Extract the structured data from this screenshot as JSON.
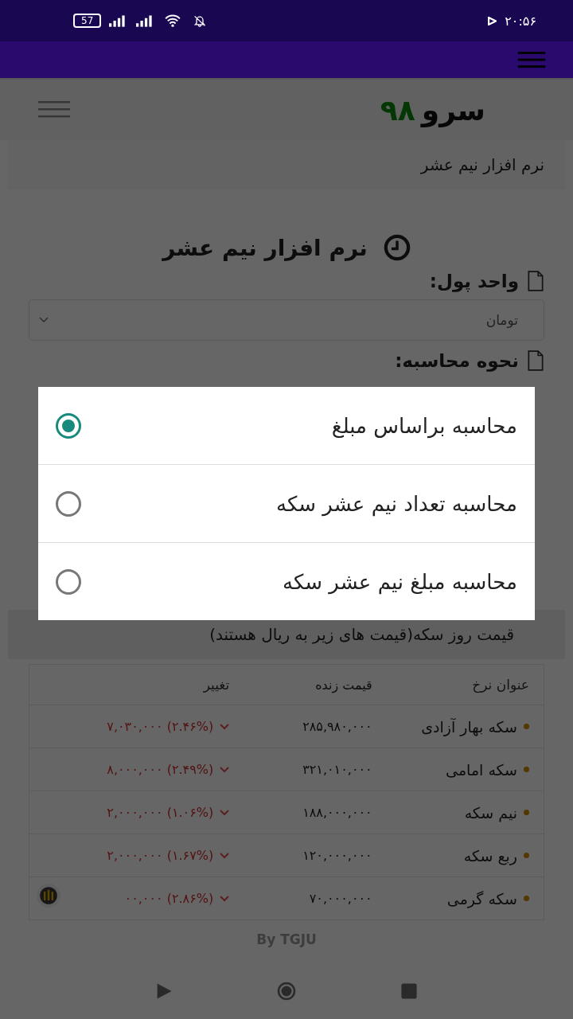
{
  "status_bar": {
    "battery": "57",
    "time": "۲۰:۵۶"
  },
  "header": {
    "logo_name": "سرو",
    "logo_number": "۹۸"
  },
  "breadcrumb": "نرم افزار نیم عشر",
  "form": {
    "title": "نرم افزار نیم عشر",
    "currency_label": "واحد پول:",
    "currency_value": "تومان",
    "method_label": "نحوه محاسبه:"
  },
  "prices": {
    "heading": "قیمت روز سکه(قیمت های زیر به ریال هستند)",
    "columns": [
      "عنوان نرخ",
      "قیمت زنده",
      "تغییر"
    ],
    "rows": [
      {
        "name": "سکه بهار آزادی",
        "price": "۲۸۵,۹۸۰,۰۰۰",
        "change": "۷,۰۳۰,۰۰۰ (۲.۴۶%)"
      },
      {
        "name": "سکه امامی",
        "price": "۳۲۱,۰۱۰,۰۰۰",
        "change": "۸,۰۰۰,۰۰۰ (۲.۴۹%)"
      },
      {
        "name": "نیم سکه",
        "price": "۱۸۸,۰۰۰,۰۰۰",
        "change": "۲,۰۰۰,۰۰۰ (۱.۰۶%)"
      },
      {
        "name": "ربع سکه",
        "price": "۱۲۰,۰۰۰,۰۰۰",
        "change": "۲,۰۰۰,۰۰۰ (۱.۶۷%)"
      },
      {
        "name": "سکه گرمی",
        "price": "۷۰,۰۰۰,۰۰۰",
        "change": "۰۰,۰۰۰ (۲.۸۶%)"
      }
    ],
    "credit": "By TGJU"
  },
  "dialog": {
    "options": [
      {
        "label": "محاسبه براساس مبلغ",
        "selected": true
      },
      {
        "label": "محاسبه تعداد نیم عشر سکه",
        "selected": false
      },
      {
        "label": "محاسبه مبلغ نیم عشر سکه",
        "selected": false
      }
    ]
  }
}
